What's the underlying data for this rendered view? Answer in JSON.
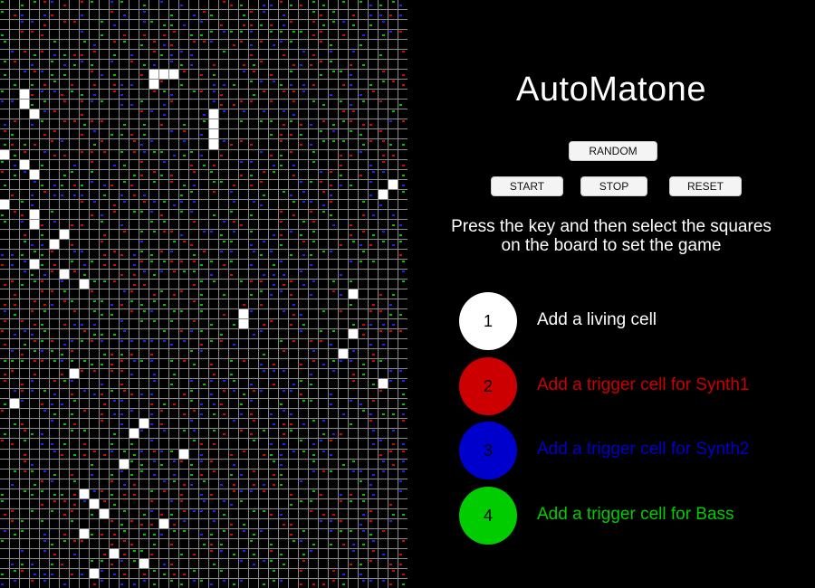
{
  "app": {
    "title": "AutoMatone"
  },
  "controls": {
    "random_label": "RANDOM",
    "start_label": "START",
    "stop_label": "STOP",
    "reset_label": "RESET"
  },
  "instructions": {
    "line1": "Press the key and then select the squares",
    "line2": "on the board to set the game"
  },
  "keys": [
    {
      "key": "1",
      "label": "Add a living cell",
      "circle_color": "#ffffff",
      "text_color": "#ffffff",
      "number_color": "#000000"
    },
    {
      "key": "2",
      "label": "Add a trigger cell for Synth1",
      "circle_color": "#cc0000",
      "text_color": "#cc0000",
      "number_color": "#000000"
    },
    {
      "key": "3",
      "label": "Add a trigger cell for Synth2",
      "circle_color": "#0000cc",
      "text_color": "#0000cc",
      "number_color": "#000000"
    },
    {
      "key": "4",
      "label": "Add a trigger cell for Bass",
      "circle_color": "#00cc00",
      "text_color": "#00cc00",
      "number_color": "#000000"
    }
  ],
  "board": {
    "colors": {
      "alive": "#ffffff",
      "dead": "#000000",
      "grid": "#8a8a8a",
      "synth1_marker": "#e00000",
      "synth2_marker": "#2020ff",
      "bass_marker": "#00c000"
    }
  }
}
